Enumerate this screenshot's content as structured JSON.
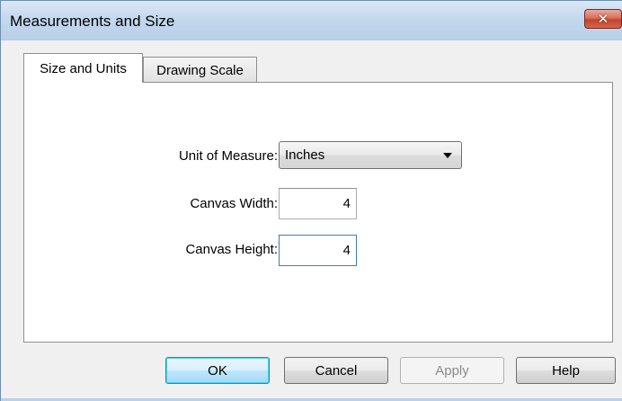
{
  "window": {
    "title": "Measurements and Size",
    "close_glyph": "✕"
  },
  "tabs": [
    {
      "label": "Size and Units",
      "active": true
    },
    {
      "label": "Drawing Scale",
      "active": false
    }
  ],
  "form": {
    "unit_label": "Unit of Measure:",
    "unit_value": "Inches",
    "width_label": "Canvas Width:",
    "width_value": "4",
    "height_label": "Canvas Height:",
    "height_value": "4"
  },
  "buttons": {
    "ok": "OK",
    "cancel": "Cancel",
    "apply": "Apply",
    "help": "Help"
  },
  "colors": {
    "titlebar": "#c4d8ee",
    "close_button": "#c2442c",
    "default_button_border": "#3c7fb1"
  },
  "icons": {
    "close": "close-icon",
    "dropdown": "chevron-down-icon"
  }
}
